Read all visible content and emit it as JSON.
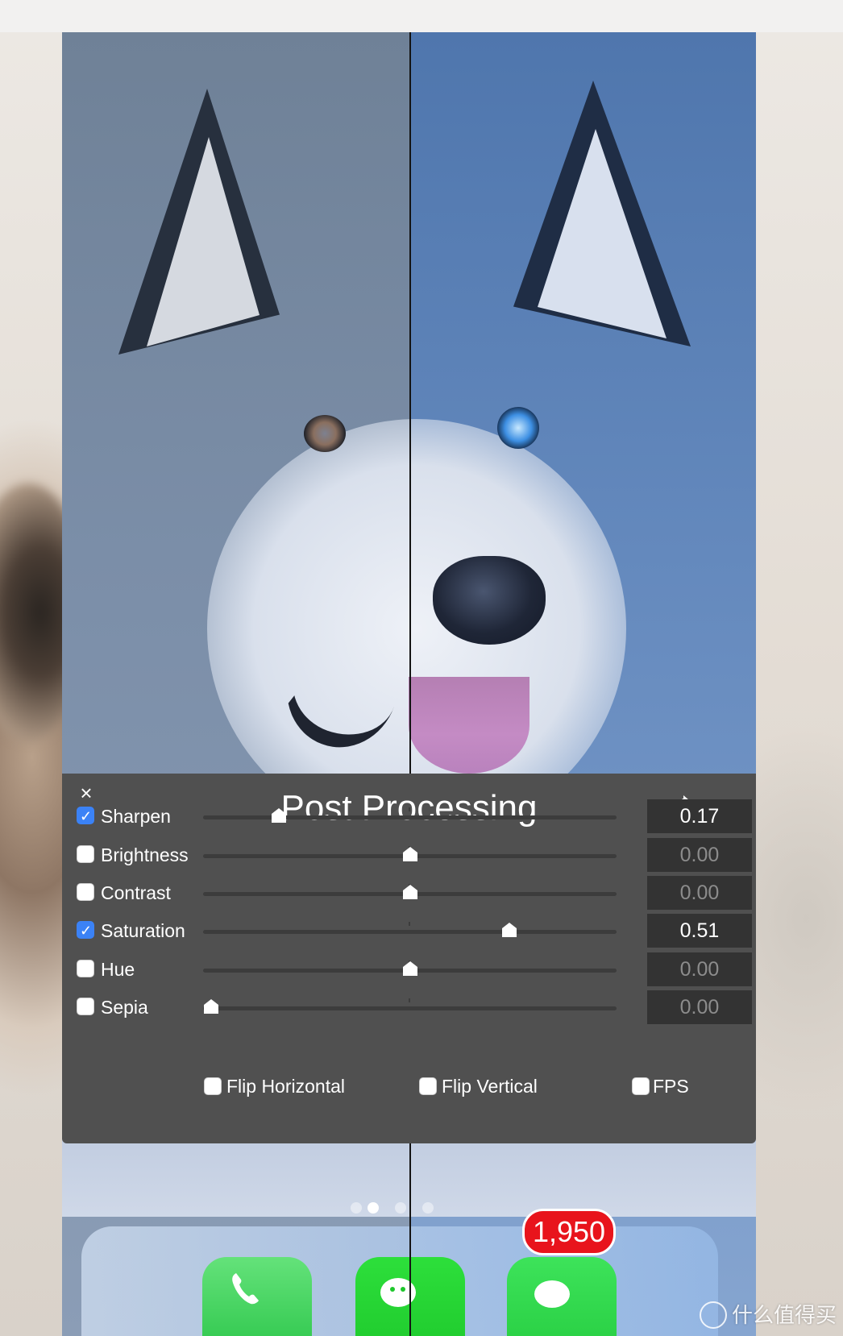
{
  "panel": {
    "title": "Post Processing",
    "close_label": "×",
    "rows": [
      {
        "label": "Sharpen",
        "checked": true,
        "value": "0.17",
        "level": 0.17
      },
      {
        "label": "Brightness",
        "checked": false,
        "value": "0.00",
        "level": 0.5
      },
      {
        "label": "Contrast",
        "checked": false,
        "value": "0.00",
        "level": 0.5
      },
      {
        "label": "Saturation",
        "checked": true,
        "value": "0.51",
        "level": 0.75
      },
      {
        "label": "Hue",
        "checked": false,
        "value": "0.00",
        "level": 0.5
      },
      {
        "label": "Sepia",
        "checked": false,
        "value": "0.00",
        "level": 0.0
      }
    ],
    "options": [
      {
        "label": "Flip Horizontal",
        "checked": false
      },
      {
        "label": "Flip Vertical",
        "checked": false
      },
      {
        "label": "FPS",
        "checked": false
      }
    ],
    "accent_color": "#3b82f6"
  },
  "dock": {
    "message_badge": "1,950",
    "apps": [
      "phone-icon",
      "wechat-icon",
      "messages-icon"
    ]
  },
  "page_indicator": {
    "count": 4,
    "active_index": 1
  },
  "watermark": {
    "text": "什么值得买"
  }
}
